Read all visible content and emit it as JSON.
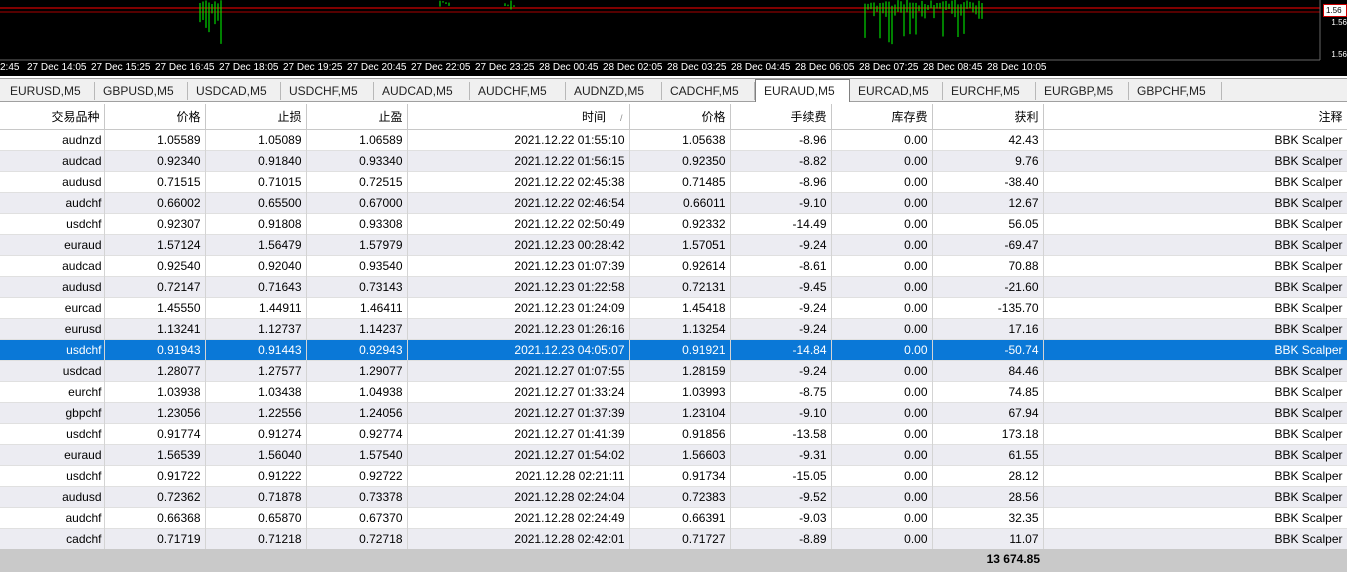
{
  "chart": {
    "time_labels": [
      "2:45",
      "27 Dec 14:05",
      "27 Dec 15:25",
      "27 Dec 16:45",
      "27 Dec 18:05",
      "27 Dec 19:25",
      "27 Dec 20:45",
      "27 Dec 22:05",
      "27 Dec 23:25",
      "28 Dec 00:45",
      "28 Dec 02:05",
      "28 Dec 03:25",
      "28 Dec 04:45",
      "28 Dec 06:05",
      "28 Dec 07:25",
      "28 Dec 08:45",
      "28 Dec 10:05"
    ],
    "price_labels": {
      "top": "1.56",
      "mid": "1.56",
      "bottom": "1.56"
    },
    "line_color": "#ff0000",
    "candle_color": "#00ff00"
  },
  "tabs": [
    "EURUSD,M5",
    "GBPUSD,M5",
    "USDCAD,M5",
    "USDCHF,M5",
    "AUDCAD,M5",
    "AUDCHF,M5",
    "AUDNZD,M5",
    "CADCHF,M5",
    "EURAUD,M5",
    "EURCAD,M5",
    "EURCHF,M5",
    "EURGBP,M5",
    "GBPCHF,M5"
  ],
  "active_tab": "EURAUD,M5",
  "columns": [
    "交易品种",
    "价格",
    "止损",
    "止盈",
    "时间",
    "价格",
    "手续费",
    "库存费",
    "获利",
    "注释"
  ],
  "sort_indicator": "/",
  "rows": [
    [
      "audnzd",
      "1.05589",
      "1.05089",
      "1.06589",
      "2021.12.22 01:55:10",
      "1.05638",
      "-8.96",
      "0.00",
      "42.43",
      "BBK Scalper"
    ],
    [
      "audcad",
      "0.92340",
      "0.91840",
      "0.93340",
      "2021.12.22 01:56:15",
      "0.92350",
      "-8.82",
      "0.00",
      "9.76",
      "BBK Scalper"
    ],
    [
      "audusd",
      "0.71515",
      "0.71015",
      "0.72515",
      "2021.12.22 02:45:38",
      "0.71485",
      "-8.96",
      "0.00",
      "-38.40",
      "BBK Scalper"
    ],
    [
      "audchf",
      "0.66002",
      "0.65500",
      "0.67000",
      "2021.12.22 02:46:54",
      "0.66011",
      "-9.10",
      "0.00",
      "12.67",
      "BBK Scalper"
    ],
    [
      "usdchf",
      "0.92307",
      "0.91808",
      "0.93308",
      "2021.12.22 02:50:49",
      "0.92332",
      "-14.49",
      "0.00",
      "56.05",
      "BBK Scalper"
    ],
    [
      "euraud",
      "1.57124",
      "1.56479",
      "1.57979",
      "2021.12.23 00:28:42",
      "1.57051",
      "-9.24",
      "0.00",
      "-69.47",
      "BBK Scalper"
    ],
    [
      "audcad",
      "0.92540",
      "0.92040",
      "0.93540",
      "2021.12.23 01:07:39",
      "0.92614",
      "-8.61",
      "0.00",
      "70.88",
      "BBK Scalper"
    ],
    [
      "audusd",
      "0.72147",
      "0.71643",
      "0.73143",
      "2021.12.23 01:22:58",
      "0.72131",
      "-9.45",
      "0.00",
      "-21.60",
      "BBK Scalper"
    ],
    [
      "eurcad",
      "1.45550",
      "1.44911",
      "1.46411",
      "2021.12.23 01:24:09",
      "1.45418",
      "-9.24",
      "0.00",
      "-135.70",
      "BBK Scalper"
    ],
    [
      "eurusd",
      "1.13241",
      "1.12737",
      "1.14237",
      "2021.12.23 01:26:16",
      "1.13254",
      "-9.24",
      "0.00",
      "17.16",
      "BBK Scalper"
    ],
    [
      "usdchf",
      "0.91943",
      "0.91443",
      "0.92943",
      "2021.12.23 04:05:07",
      "0.91921",
      "-14.84",
      "0.00",
      "-50.74",
      "BBK Scalper"
    ],
    [
      "usdcad",
      "1.28077",
      "1.27577",
      "1.29077",
      "2021.12.27 01:07:55",
      "1.28159",
      "-9.24",
      "0.00",
      "84.46",
      "BBK Scalper"
    ],
    [
      "eurchf",
      "1.03938",
      "1.03438",
      "1.04938",
      "2021.12.27 01:33:24",
      "1.03993",
      "-8.75",
      "0.00",
      "74.85",
      "BBK Scalper"
    ],
    [
      "gbpchf",
      "1.23056",
      "1.22556",
      "1.24056",
      "2021.12.27 01:37:39",
      "1.23104",
      "-9.10",
      "0.00",
      "67.94",
      "BBK Scalper"
    ],
    [
      "usdchf",
      "0.91774",
      "0.91274",
      "0.92774",
      "2021.12.27 01:41:39",
      "0.91856",
      "-13.58",
      "0.00",
      "173.18",
      "BBK Scalper"
    ],
    [
      "euraud",
      "1.56539",
      "1.56040",
      "1.57540",
      "2021.12.27 01:54:02",
      "1.56603",
      "-9.31",
      "0.00",
      "61.55",
      "BBK Scalper"
    ],
    [
      "usdchf",
      "0.91722",
      "0.91222",
      "0.92722",
      "2021.12.28 02:21:11",
      "0.91734",
      "-15.05",
      "0.00",
      "28.12",
      "BBK Scalper"
    ],
    [
      "audusd",
      "0.72362",
      "0.71878",
      "0.73378",
      "2021.12.28 02:24:04",
      "0.72383",
      "-9.52",
      "0.00",
      "28.56",
      "BBK Scalper"
    ],
    [
      "audchf",
      "0.66368",
      "0.65870",
      "0.67370",
      "2021.12.28 02:24:49",
      "0.66391",
      "-9.03",
      "0.00",
      "32.35",
      "BBK Scalper"
    ],
    [
      "cadchf",
      "0.71719",
      "0.71218",
      "0.72718",
      "2021.12.28 02:42:01",
      "0.71727",
      "-8.89",
      "0.00",
      "11.07",
      "BBK Scalper"
    ]
  ],
  "selected_row_index": 10,
  "total_profit": "13 674.85",
  "colors": {
    "selected_row": "#0a78d7",
    "alt_row": "#ececf2",
    "footer": "#c9c9c9"
  }
}
